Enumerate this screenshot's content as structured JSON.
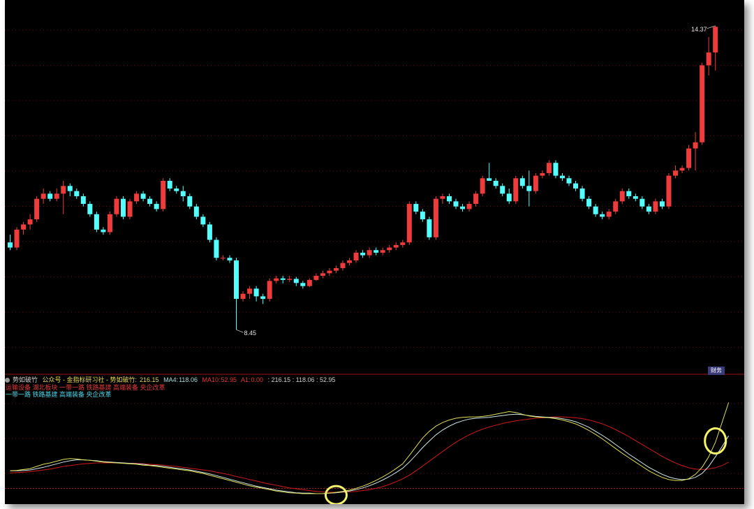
{
  "indicator": {
    "name": "势如破竹",
    "source": "公众号 - 金指标研习社 - 势如破竹:",
    "value": "216.15",
    "ma4_label": "MA4:",
    "ma4": "118.06",
    "ma10_label": "MA10:",
    "ma10": "52.95",
    "a1_label": "A1:",
    "a1": "0.00",
    "tail": ": 216.15 : 118.06 : 52.95",
    "tags_line1": "运输设备 湖北板块 一带一路 铁路基建 高端装备 央企改革",
    "tags_line2": "一带一路 铁路基建 高端装备 央企改革"
  },
  "fin_badge": "财务",
  "colors": {
    "up": "#ee3b3b",
    "down": "#54ffff",
    "ma_white": "#cfe7e7",
    "ma_yellow": "#dede55",
    "ma_red": "#c01818",
    "grid": "#8a1010",
    "highlight": "#f5f36a"
  },
  "chart_data": {
    "type": "candlestick",
    "price_range": [
      7.8,
      14.6
    ],
    "max_label": "14.37",
    "min_label": "8.45",
    "candles": [
      [
        10.15,
        10.3,
        10.0,
        10.05
      ],
      [
        10.05,
        10.45,
        10.0,
        10.4
      ],
      [
        10.4,
        10.55,
        10.3,
        10.5
      ],
      [
        10.5,
        10.7,
        10.4,
        10.6
      ],
      [
        10.6,
        11.05,
        10.55,
        11.0
      ],
      [
        11.0,
        11.2,
        10.9,
        11.1
      ],
      [
        11.1,
        11.15,
        10.95,
        11.0
      ],
      [
        11.0,
        11.2,
        10.95,
        11.1
      ],
      [
        11.1,
        11.35,
        10.7,
        11.25
      ],
      [
        11.25,
        11.3,
        11.05,
        11.15
      ],
      [
        11.15,
        11.2,
        11.0,
        11.05
      ],
      [
        11.05,
        11.1,
        10.85,
        10.9
      ],
      [
        10.9,
        10.95,
        10.65,
        10.7
      ],
      [
        10.7,
        10.75,
        10.35,
        10.4
      ],
      [
        10.4,
        10.45,
        10.3,
        10.35
      ],
      [
        10.35,
        10.75,
        10.3,
        10.7
      ],
      [
        10.7,
        11.05,
        10.65,
        11.0
      ],
      [
        11.0,
        11.05,
        10.6,
        10.65
      ],
      [
        10.65,
        11.0,
        10.6,
        10.95
      ],
      [
        10.95,
        11.15,
        10.9,
        11.1
      ],
      [
        11.1,
        11.15,
        10.95,
        11.0
      ],
      [
        11.0,
        11.05,
        10.85,
        10.9
      ],
      [
        10.9,
        10.95,
        10.75,
        10.8
      ],
      [
        10.8,
        11.4,
        10.75,
        11.35
      ],
      [
        11.35,
        11.4,
        11.15,
        11.2
      ],
      [
        11.2,
        11.25,
        11.1,
        11.15
      ],
      [
        11.15,
        11.25,
        10.95,
        11.05
      ],
      [
        11.05,
        11.1,
        10.8,
        10.85
      ],
      [
        10.85,
        10.9,
        10.6,
        10.65
      ],
      [
        10.65,
        10.7,
        10.45,
        10.5
      ],
      [
        10.5,
        10.55,
        10.15,
        10.2
      ],
      [
        10.2,
        10.25,
        9.8,
        9.85
      ],
      [
        9.85,
        9.9,
        9.8,
        9.85
      ],
      [
        9.85,
        9.9,
        9.75,
        9.8
      ],
      [
        9.8,
        9.85,
        8.45,
        9.05
      ],
      [
        9.05,
        9.2,
        9.0,
        9.15
      ],
      [
        9.15,
        9.3,
        9.05,
        9.25
      ],
      [
        9.25,
        9.3,
        9.0,
        9.1
      ],
      [
        9.1,
        9.15,
        8.95,
        9.05
      ],
      [
        9.05,
        9.45,
        9.0,
        9.4
      ],
      [
        9.4,
        9.5,
        9.35,
        9.45
      ],
      [
        9.45,
        9.5,
        9.35,
        9.42
      ],
      [
        9.42,
        9.5,
        9.38,
        9.44
      ],
      [
        9.44,
        9.48,
        9.3,
        9.36
      ],
      [
        9.36,
        9.4,
        9.25,
        9.3
      ],
      [
        9.3,
        9.45,
        9.28,
        9.42
      ],
      [
        9.42,
        9.55,
        9.4,
        9.5
      ],
      [
        9.5,
        9.6,
        9.45,
        9.55
      ],
      [
        9.55,
        9.65,
        9.5,
        9.6
      ],
      [
        9.6,
        9.7,
        9.55,
        9.65
      ],
      [
        9.65,
        9.8,
        9.6,
        9.75
      ],
      [
        9.75,
        9.85,
        9.7,
        9.8
      ],
      [
        9.8,
        10.0,
        9.75,
        9.95
      ],
      [
        9.95,
        10.0,
        9.85,
        9.9
      ],
      [
        9.9,
        10.05,
        9.85,
        10.0
      ],
      [
        10.0,
        10.05,
        9.9,
        9.95
      ],
      [
        9.95,
        10.05,
        9.9,
        10.0
      ],
      [
        10.0,
        10.1,
        9.95,
        10.05
      ],
      [
        10.05,
        10.15,
        10.0,
        10.1
      ],
      [
        10.1,
        10.2,
        10.05,
        10.15
      ],
      [
        10.15,
        10.95,
        10.1,
        10.9
      ],
      [
        10.9,
        10.95,
        10.7,
        10.75
      ],
      [
        10.75,
        10.8,
        10.55,
        10.6
      ],
      [
        10.6,
        10.65,
        10.2,
        10.25
      ],
      [
        10.25,
        11.05,
        10.2,
        11.0
      ],
      [
        11.0,
        11.1,
        10.9,
        11.05
      ],
      [
        11.05,
        11.1,
        10.9,
        10.95
      ],
      [
        10.95,
        11.0,
        10.8,
        10.85
      ],
      [
        10.85,
        10.9,
        10.75,
        10.8
      ],
      [
        10.8,
        10.95,
        10.75,
        10.9
      ],
      [
        10.9,
        11.15,
        10.85,
        11.1
      ],
      [
        11.1,
        11.45,
        11.05,
        11.4
      ],
      [
        11.4,
        11.7,
        11.35,
        11.35
      ],
      [
        11.35,
        11.4,
        11.2,
        11.25
      ],
      [
        11.25,
        11.3,
        11.05,
        11.1
      ],
      [
        11.1,
        11.2,
        10.9,
        10.95
      ],
      [
        10.95,
        11.45,
        10.9,
        11.4
      ],
      [
        11.4,
        11.45,
        11.2,
        11.25
      ],
      [
        11.25,
        11.55,
        10.85,
        11.15
      ],
      [
        11.15,
        11.5,
        11.1,
        11.45
      ],
      [
        11.45,
        11.55,
        11.4,
        11.5
      ],
      [
        11.5,
        11.75,
        11.45,
        11.7
      ],
      [
        11.7,
        11.75,
        11.4,
        11.45
      ],
      [
        11.45,
        11.5,
        11.35,
        11.4
      ],
      [
        11.4,
        11.45,
        11.25,
        11.3
      ],
      [
        11.3,
        11.35,
        11.15,
        11.2
      ],
      [
        11.2,
        11.25,
        10.95,
        11.0
      ],
      [
        11.0,
        11.05,
        10.8,
        10.85
      ],
      [
        10.85,
        10.9,
        10.65,
        10.7
      ],
      [
        10.7,
        10.75,
        10.6,
        10.65
      ],
      [
        10.65,
        10.8,
        10.6,
        10.75
      ],
      [
        10.75,
        11.0,
        10.7,
        10.95
      ],
      [
        10.95,
        11.2,
        10.9,
        11.15
      ],
      [
        11.15,
        11.2,
        11.0,
        11.05
      ],
      [
        11.05,
        11.1,
        10.95,
        11.0
      ],
      [
        11.0,
        11.05,
        10.8,
        10.85
      ],
      [
        10.85,
        10.9,
        10.7,
        10.75
      ],
      [
        10.75,
        11.0,
        10.7,
        10.95
      ],
      [
        10.95,
        11.0,
        10.8,
        10.85
      ],
      [
        10.85,
        11.5,
        10.8,
        11.45
      ],
      [
        11.45,
        11.65,
        11.4,
        11.55
      ],
      [
        11.55,
        11.65,
        11.5,
        11.6
      ],
      [
        11.6,
        12.05,
        11.55,
        11.98
      ],
      [
        11.98,
        12.3,
        11.55,
        12.1
      ],
      [
        12.1,
        13.65,
        12.05,
        13.6
      ],
      [
        13.6,
        14.15,
        13.4,
        13.85
      ],
      [
        13.85,
        14.37,
        13.5,
        14.35
      ]
    ],
    "indicator_lines": {
      "range": [
        0,
        250
      ],
      "main": [
        60,
        61,
        63,
        65,
        70,
        75,
        78,
        82,
        86,
        88,
        87,
        85,
        84,
        82,
        80,
        79,
        78,
        77,
        76,
        75,
        73,
        72,
        70,
        68,
        66,
        64,
        62,
        60,
        57,
        54,
        50,
        46,
        42,
        38,
        34,
        30,
        26,
        23,
        20,
        17,
        14,
        12,
        10,
        9,
        8,
        8,
        8,
        8,
        9,
        11,
        13,
        16,
        20,
        25,
        31,
        38,
        46,
        55,
        65,
        76,
        95,
        115,
        135,
        150,
        162,
        170,
        176,
        180,
        182,
        183,
        183,
        184,
        186,
        189,
        192,
        195,
        193,
        189,
        185,
        183,
        182,
        181,
        179,
        176,
        172,
        167,
        160,
        152,
        143,
        133,
        122,
        111,
        100,
        90,
        80,
        70,
        60,
        52,
        45,
        40,
        38,
        38,
        42,
        52,
        68,
        92,
        125,
        170,
        216
      ],
      "ma4": [
        60,
        60,
        61,
        62,
        65,
        68,
        72,
        76,
        80,
        83,
        85,
        85,
        84,
        83,
        81,
        80,
        79,
        78,
        77,
        76,
        75,
        73,
        72,
        70,
        68,
        66,
        64,
        62,
        59,
        56,
        53,
        49,
        45,
        41,
        37,
        33,
        29,
        25,
        22,
        19,
        16,
        14,
        12,
        10,
        9,
        9,
        8,
        8,
        9,
        10,
        12,
        14,
        17,
        21,
        26,
        32,
        39,
        47,
        56,
        66,
        80,
        96,
        113,
        128,
        142,
        153,
        162,
        169,
        174,
        178,
        180,
        181,
        182,
        184,
        186,
        188,
        189,
        188,
        186,
        184,
        183,
        182,
        181,
        179,
        176,
        172,
        166,
        159,
        150,
        141,
        131,
        120,
        109,
        98,
        88,
        78,
        68,
        60,
        52,
        46,
        42,
        40,
        41,
        45,
        54,
        70,
        92,
        115,
        140
      ],
      "ma10": [
        55,
        56,
        57,
        58,
        60,
        62,
        64,
        67,
        70,
        72,
        74,
        76,
        77,
        78,
        78,
        78,
        78,
        78,
        77,
        77,
        76,
        75,
        74,
        73,
        71,
        70,
        68,
        66,
        64,
        62,
        60,
        57,
        54,
        51,
        47,
        44,
        40,
        37,
        33,
        30,
        27,
        24,
        21,
        19,
        17,
        15,
        13,
        12,
        11,
        11,
        11,
        12,
        13,
        15,
        17,
        20,
        24,
        29,
        35,
        42,
        50,
        60,
        71,
        82,
        93,
        104,
        115,
        125,
        134,
        142,
        149,
        155,
        160,
        164,
        168,
        171,
        174,
        176,
        178,
        180,
        181,
        182,
        183,
        183,
        182,
        181,
        179,
        176,
        172,
        167,
        161,
        154,
        146,
        138,
        129,
        120,
        111,
        102,
        93,
        85,
        78,
        72,
        67,
        64,
        63,
        64,
        67,
        72,
        80
      ],
      "threshold": 20
    }
  }
}
